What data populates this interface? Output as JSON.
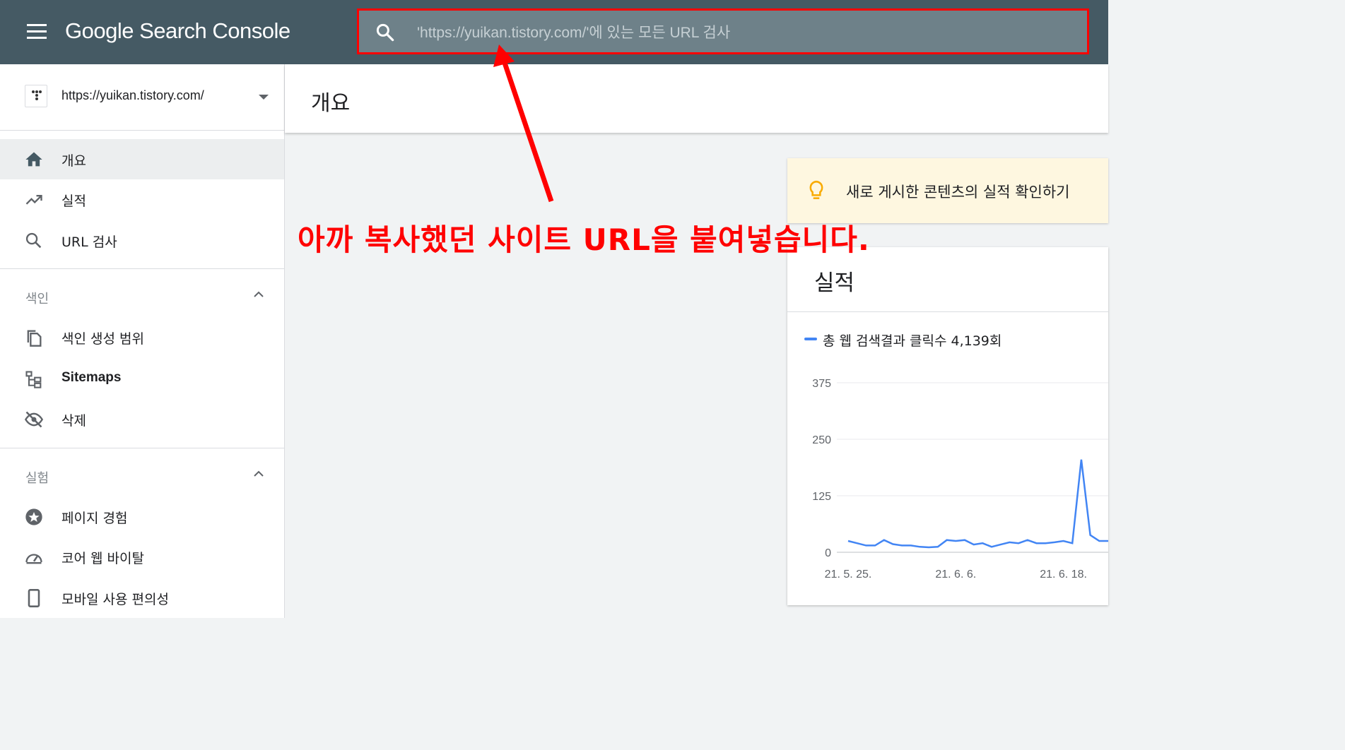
{
  "app": {
    "logo_text": "Google Search Console"
  },
  "search": {
    "placeholder": "'https://yuikan.tistory.com/'에 있는 모든 URL 검사"
  },
  "sidebar": {
    "property_url": "https://yuikan.tistory.com/",
    "items": [
      {
        "label": "개요",
        "icon": "home-icon",
        "active": true
      },
      {
        "label": "실적",
        "icon": "trending-up-icon"
      },
      {
        "label": "URL 검사",
        "icon": "search-icon"
      }
    ],
    "sections": [
      {
        "label": "색인",
        "items": [
          {
            "label": "색인 생성 범위",
            "icon": "copy-pages-icon"
          },
          {
            "label": "Sitemaps",
            "icon": "sitemap-icon"
          },
          {
            "label": "삭제",
            "icon": "visibility-off-icon"
          }
        ]
      },
      {
        "label": "실험",
        "items": [
          {
            "label": "페이지 경험",
            "icon": "star-badge-icon"
          },
          {
            "label": "코어 웹 바이탈",
            "icon": "speedometer-icon"
          },
          {
            "label": "모바일 사용 편의성",
            "icon": "smartphone-icon"
          }
        ]
      }
    ]
  },
  "main": {
    "title": "개요",
    "tip_text": "새로 게시한 콘텐츠의 실적 확인하기",
    "performance": {
      "title": "실적",
      "legend": "총 웹 검색결과 클릭수 4,139회"
    }
  },
  "annotation": {
    "text": "아까 복사했던 사이트 URL을 붙여넣습니다."
  },
  "colors": {
    "topbar": "#455a64",
    "accent": "#4285f4",
    "annotation": "#ff0000"
  },
  "chart_data": {
    "type": "line",
    "title": "",
    "xlabel": "",
    "ylabel": "",
    "x_tick_labels": [
      "21. 5. 25.",
      "21. 6. 6.",
      "21. 6. 18."
    ],
    "y_ticks": [
      0,
      125,
      250,
      375
    ],
    "ylim": [
      0,
      375
    ],
    "grid": true,
    "series": [
      {
        "name": "총 웹 검색결과 클릭수",
        "color": "#4285f4",
        "values": [
          25,
          20,
          15,
          15,
          27,
          18,
          15,
          15,
          12,
          11,
          12,
          27,
          25,
          27,
          17,
          20,
          12,
          17,
          22,
          20,
          27,
          20,
          20,
          22,
          25,
          20,
          205,
          38,
          25,
          25
        ]
      }
    ]
  }
}
